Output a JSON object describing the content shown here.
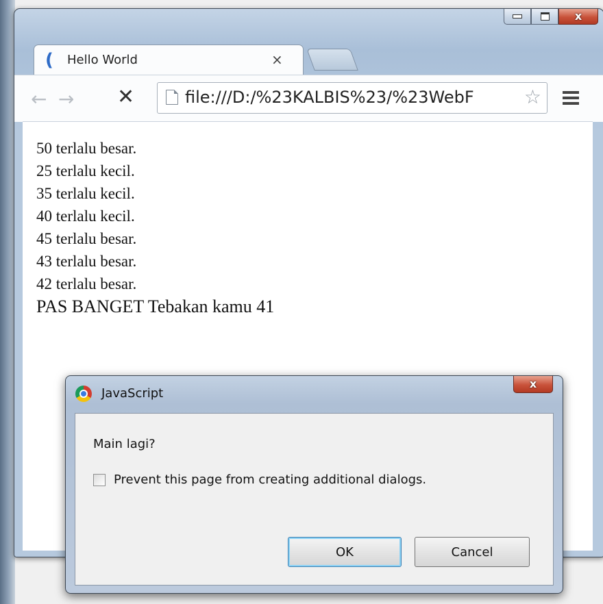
{
  "browser": {
    "tab_title": "Hello World",
    "tab_close": "×",
    "nav_back": "←",
    "nav_forward": "→",
    "nav_stop": "✕",
    "url": "file:///D:/%23KALBIS%23/%23WebF",
    "star": "☆",
    "window_close": "x",
    "icons": {
      "tab_favicon": "loading-spinner-icon",
      "page": "page-icon",
      "star": "star-icon",
      "menu": "menu-icon"
    }
  },
  "page": {
    "lines": [
      "50 terlalu besar.",
      "25 terlalu kecil.",
      "35 terlalu kecil.",
      "40 terlalu kecil.",
      "45 terlalu besar.",
      "43 terlalu besar.",
      "42 terlalu besar.",
      "PAS BANGET Tebakan kamu 41"
    ]
  },
  "dialog": {
    "title": "JavaScript",
    "close": "x",
    "message": "Main lagi?",
    "checkbox_label": "Prevent this page from creating additional dialogs.",
    "checkbox_checked": false,
    "ok_label": "OK",
    "cancel_label": "Cancel",
    "icon": "chrome-icon"
  }
}
